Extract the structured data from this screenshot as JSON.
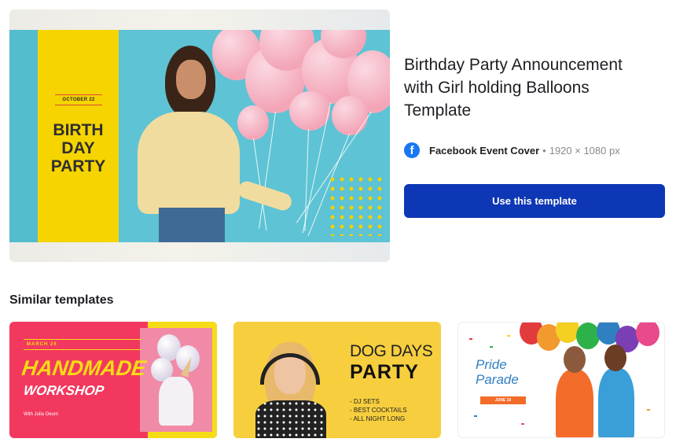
{
  "preview": {
    "date_tag": "OCTOBER 22",
    "art_title": "BIRTH\nDAY\nPARTY"
  },
  "details": {
    "title": "Birthday Party Announcement with Girl holding Balloons Template",
    "format_icon": "facebook-icon",
    "format_name": "Facebook Event Cover",
    "separator": "•",
    "format_size": "1920 × 1080 px",
    "use_button_label": "Use this template",
    "button_color": "#0d37b5"
  },
  "similar": {
    "heading": "Similar templates",
    "items": [
      {
        "date": "MARCH 26",
        "title": "HANDMADE",
        "subtitle": "WORKSHOP",
        "credit": "With Julia Oeum"
      },
      {
        "title_line1": "DOG DAYS",
        "title_line2": "PARTY",
        "list": "- DJ SETS\n- BEST COCKTAILS\n- ALL NIGHT LONG"
      },
      {
        "title": "Pride\nParade",
        "banner": "JUNE 10"
      }
    ]
  }
}
